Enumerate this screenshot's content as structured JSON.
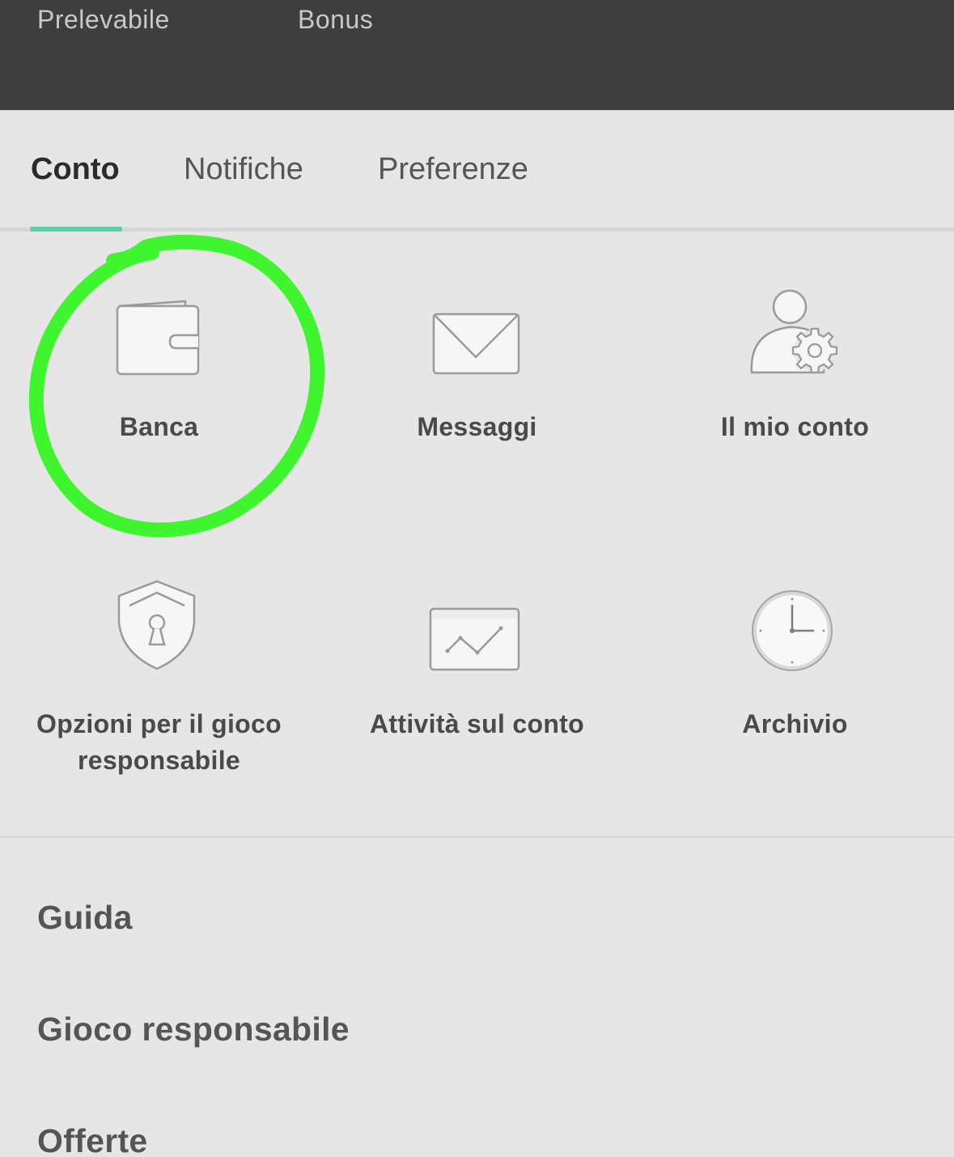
{
  "balance_header": {
    "withdrawable_label": "Prelevabile",
    "bonus_label": "Bonus"
  },
  "tabs": [
    {
      "label": "Conto",
      "active": true
    },
    {
      "label": "Notifiche",
      "active": false
    },
    {
      "label": "Preferenze",
      "active": false
    }
  ],
  "accent_color": "#5fcfae",
  "annotation_color": "#3ff52e",
  "tiles": [
    {
      "label": "Banca",
      "icon": "wallet-icon"
    },
    {
      "label": "Messaggi",
      "icon": "envelope-icon"
    },
    {
      "label": "Il mio conto",
      "icon": "user-settings-icon"
    },
    {
      "label": "Opzioni per il gioco responsabile",
      "icon": "shield-keyhole-icon"
    },
    {
      "label": "Attività sul conto",
      "icon": "activity-chart-icon"
    },
    {
      "label": "Archivio",
      "icon": "clock-icon"
    }
  ],
  "menu": [
    {
      "label": "Guida"
    },
    {
      "label": "Gioco responsabile"
    },
    {
      "label": "Offerte"
    }
  ]
}
